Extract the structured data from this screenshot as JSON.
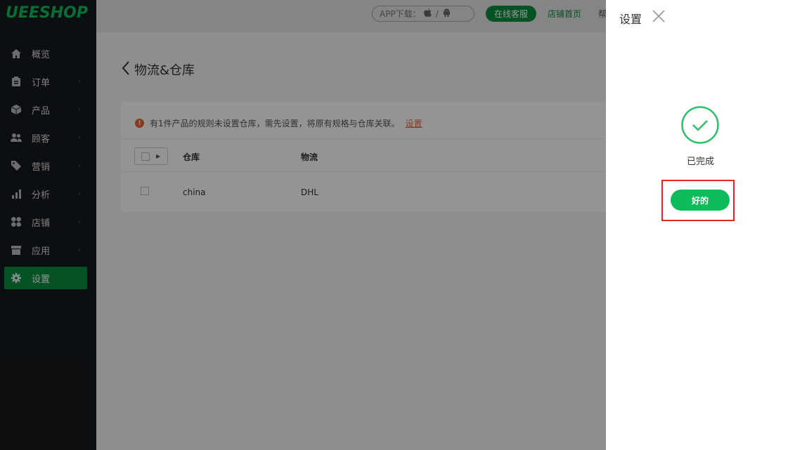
{
  "brand": {
    "logo": "UEESHOP",
    "accent": "#0ebd5a",
    "active_nav": "#0a8e3f"
  },
  "sidebar": {
    "items": [
      {
        "label": "概览",
        "icon": "home-icon"
      },
      {
        "label": "订单",
        "icon": "clipboard-icon"
      },
      {
        "label": "产品",
        "icon": "box-icon"
      },
      {
        "label": "顾客",
        "icon": "users-icon"
      },
      {
        "label": "营销",
        "icon": "tag-icon"
      },
      {
        "label": "分析",
        "icon": "bar-chart-icon"
      },
      {
        "label": "店铺",
        "icon": "grid-icon"
      },
      {
        "label": "应用",
        "icon": "store-icon"
      },
      {
        "label": "设置",
        "icon": "gear-icon",
        "active": true
      }
    ]
  },
  "topbar": {
    "app_download": "APP下载：",
    "online_service": "在线客服",
    "shop_home": "店铺首页",
    "help": "帮"
  },
  "main": {
    "title": "物流&仓库",
    "warning": {
      "text": "有1件产品的规则未设置仓库，需先设置，将原有规格与仓库关联。",
      "link": "设置"
    },
    "table": {
      "headers": [
        "仓库",
        "物流"
      ],
      "rows": [
        {
          "warehouse": "china",
          "logistics": "DHL"
        }
      ]
    }
  },
  "drawer": {
    "title": "设置",
    "status": "已完成",
    "ok_button": "好的"
  }
}
